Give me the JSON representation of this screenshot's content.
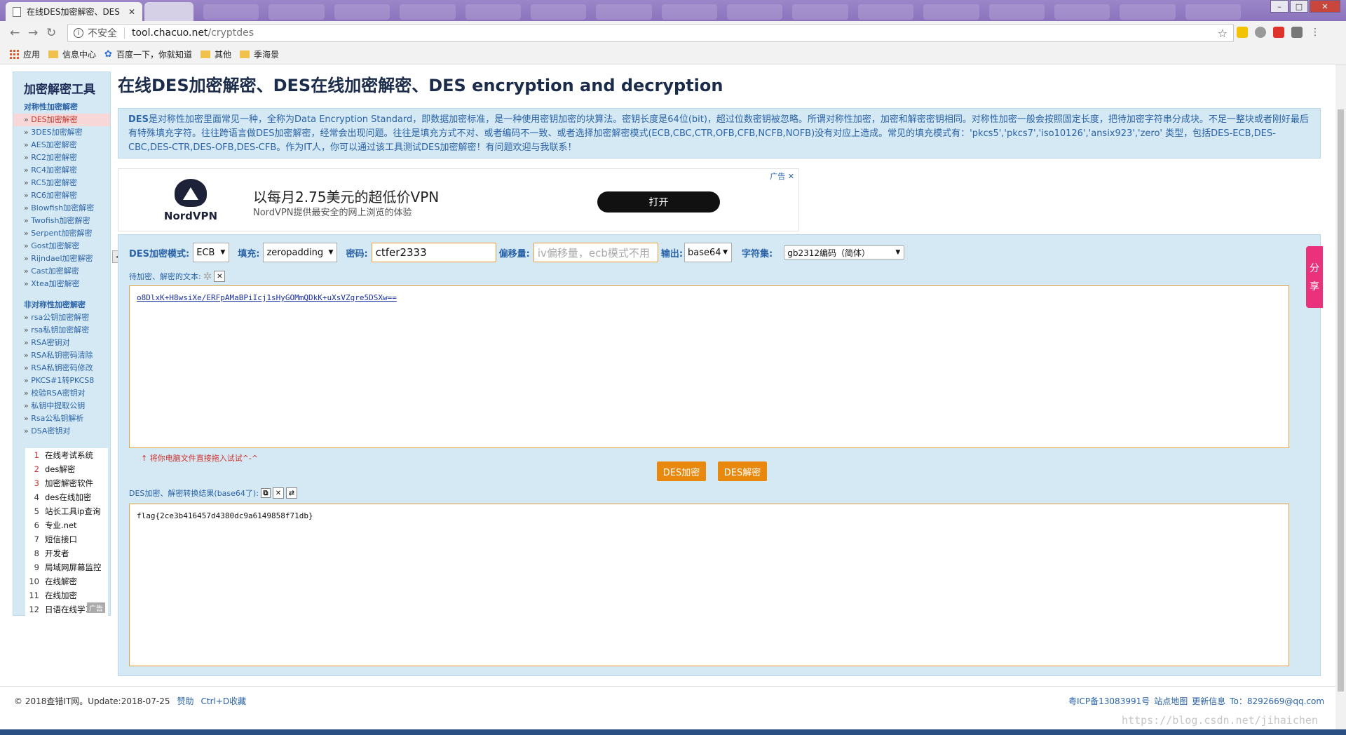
{
  "browser": {
    "active_tab_title": "在线DES加密解密、DES",
    "tab_close": "✕",
    "insecure_label": "不安全",
    "url_host": "tool.chacuo.net",
    "url_path": "/cryptdes",
    "bookmarks": [
      "应用",
      "信息中心",
      "百度一下，你就知道",
      "其他",
      "季海景"
    ]
  },
  "sidebar": {
    "title": "加密解密工具",
    "symmetric_title": "对称性加密解密",
    "symmetric_items": [
      "DES加密解密",
      "3DES加密解密",
      "AES加密解密",
      "RC2加密解密",
      "RC4加密解密",
      "RC5加密解密",
      "RC6加密解密",
      "Blowfish加密解密",
      "Twofish加密解密",
      "Serpent加密解密",
      "Gost加密解密",
      "Rijndael加密解密",
      "Cast加密解密",
      "Xtea加密解密"
    ],
    "asymmetric_title": "非对称性加密解密",
    "asymmetric_items": [
      "rsa公钥加密解密",
      "rsa私钥加密解密",
      "RSA密钥对",
      "RSA私钥密码清除",
      "RSA私钥密码修改",
      "PKCS#1转PKCS8",
      "校验RSA密钥对",
      "私钥中提取公钥",
      "Rsa公私钥解析",
      "DSA密钥对"
    ],
    "ad_items": [
      {
        "num": "1",
        "label": "在线考试系统"
      },
      {
        "num": "2",
        "label": "des解密"
      },
      {
        "num": "3",
        "label": "加密解密软件"
      },
      {
        "num": "4",
        "label": "des在线加密"
      },
      {
        "num": "5",
        "label": "站长工具ip查询"
      },
      {
        "num": "6",
        "label": "专业.net"
      },
      {
        "num": "7",
        "label": "短信接口"
      },
      {
        "num": "8",
        "label": "开发者"
      },
      {
        "num": "9",
        "label": "局域网屏幕监控"
      },
      {
        "num": "10",
        "label": "在线解密"
      },
      {
        "num": "11",
        "label": "在线加密"
      },
      {
        "num": "12",
        "label": "日语在线学习"
      }
    ],
    "ad_badge": "广告"
  },
  "main": {
    "title": "在线DES加密解密、DES在线加密解密、DES encryption and decryption",
    "desc_bold": "DES",
    "desc_text": "是对称性加密里面常见一种，全称为Data Encryption Standard，即数据加密标准，是一种使用密钥加密的块算法。密钥长度是64位(bit)，超过位数密钥被忽略。所谓对称性加密，加密和解密密钥相同。对称性加密一般会按照固定长度，把待加密字符串分成块。不足一整块或者刚好最后有特殊填充字符。往往跨语言做DES加密解密，经常会出现问题。往往是填充方式不对、或者编码不一致、或者选择加密解密模式(ECB,CBC,CTR,OFB,CFB,NCFB,NOFB)没有对应上造成。常见的填充模式有：'pkcs5','pkcs7','iso10126','ansix923','zero' 类型，包括DES-ECB,DES-CBC,DES-CTR,DES-OFB,DES-CFB。作为IT人，你可以通过该工具测试DES加密解密！有问题欢迎与我联系！"
  },
  "ad": {
    "brand": "NordVPN",
    "headline": "以每月2.75美元的超低价VPN",
    "sub": "NordVPN提供最安全的网上浏览的体验",
    "open_button": "打开",
    "label": "广告 ✕"
  },
  "form": {
    "mode_label": "DES加密模式:",
    "mode_value": "ECB",
    "padding_label": "填充:",
    "padding_value": "zeropadding",
    "key_label": "密码:",
    "key_value": "ctfer2333",
    "iv_label": "偏移量:",
    "iv_placeholder": "iv偏移量，ecb模式不用",
    "output_label": "输出:",
    "output_value": "base64",
    "charset_label": "字符集:",
    "charset_value": "gb2312编码（简体）",
    "input_label": "待加密、解密的文本:",
    "input_value": "o8DlxK+H8wsiXe/ERFpAMaBPiIcj1sHyGOMmQDkK+uXsVZgre5DSXw==",
    "hint": "↑ 将你电脑文件直接拖入试试^-^",
    "encrypt_button": "DES加密",
    "decrypt_button": "DES解密",
    "result_label": "DES加密、解密转换结果(base64了):",
    "result_value": "flag{2ce3b416457d4380dc9a6149858f71db}"
  },
  "share": {
    "chars": [
      "分",
      "享"
    ]
  },
  "footer": {
    "copyright": "© 2018查错IT网。Update:2018-07-25",
    "sponsor": "赞助",
    "bookmark_hint": "Ctrl+D收藏",
    "right": [
      "粤ICP备13083991号",
      "站点地图",
      "更新信息",
      "To：8292669@qq.com"
    ]
  },
  "watermark": "https://blog.csdn.net/jihaichen"
}
